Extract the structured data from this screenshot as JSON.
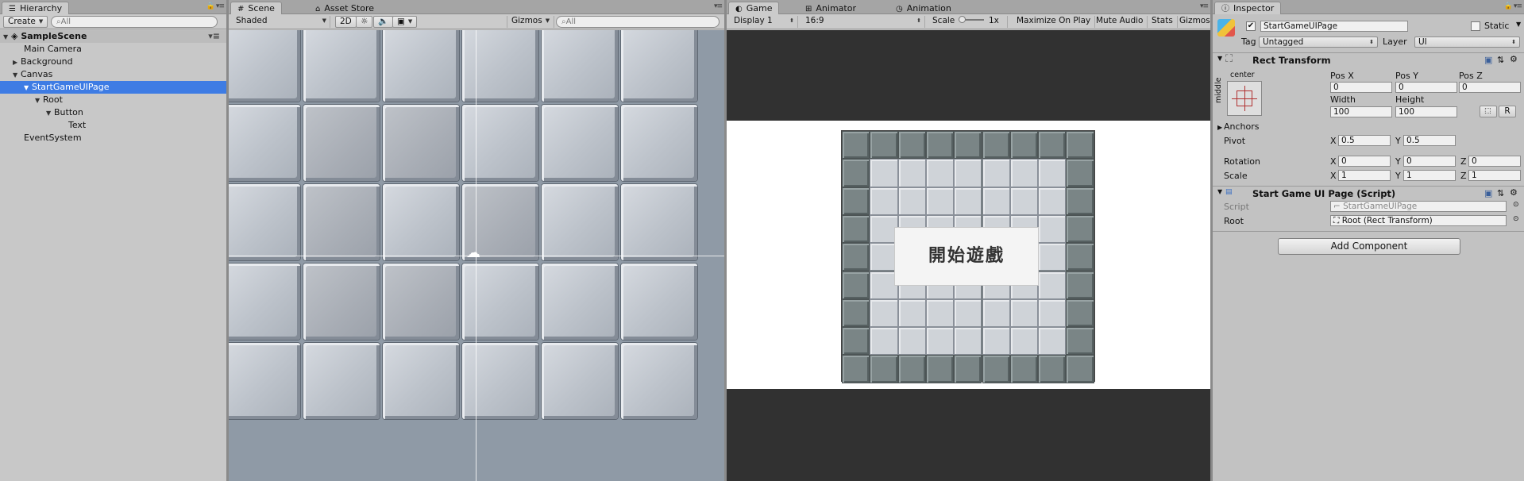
{
  "hierarchy": {
    "tab": "Hierarchy",
    "create_label": "Create",
    "search_placeholder": "All",
    "scene_name": "SampleScene",
    "items": [
      {
        "label": "Main Camera"
      },
      {
        "label": "Background"
      },
      {
        "label": "Canvas"
      },
      {
        "label": "StartGameUIPage"
      },
      {
        "label": "Root"
      },
      {
        "label": "Button"
      },
      {
        "label": "Text"
      },
      {
        "label": "EventSystem"
      }
    ]
  },
  "scene": {
    "tabs": [
      "Scene",
      "Asset Store"
    ],
    "shading_mode": "Shaded",
    "mode_2d": "2D",
    "gizmos_label": "Gizmos",
    "search_placeholder": "All"
  },
  "game": {
    "tabs": [
      "Game",
      "Animator",
      "Animation"
    ],
    "display": "Display 1",
    "aspect": "16:9",
    "scale_label": "Scale",
    "scale_value": "1x",
    "maximize_on_play": "Maximize On Play",
    "mute_audio": "Mute Audio",
    "stats": "Stats",
    "gizmos": "Gizmos",
    "start_button_text": "開始遊戲"
  },
  "inspector": {
    "tab": "Inspector",
    "object_name": "StartGameUIPage",
    "static_label": "Static",
    "tag_label": "Tag",
    "tag_value": "Untagged",
    "layer_label": "Layer",
    "layer_value": "UI",
    "rect_transform": {
      "title": "Rect Transform",
      "anchor_h": "center",
      "anchor_v": "middle",
      "pos_x_label": "Pos X",
      "pos_x": "0",
      "pos_y_label": "Pos Y",
      "pos_y": "0",
      "pos_z_label": "Pos Z",
      "pos_z": "0",
      "width_label": "Width",
      "width": "100",
      "height_label": "Height",
      "height": "100",
      "r_button": "R",
      "anchors_label": "Anchors",
      "pivot_label": "Pivot",
      "pivot_x": "0.5",
      "pivot_y": "0.5",
      "rotation_label": "Rotation",
      "rot_x": "0",
      "rot_y": "0",
      "rot_z": "0",
      "scale_label": "Scale",
      "scale_x": "1",
      "scale_y": "1",
      "scale_z": "1",
      "x": "X",
      "y": "Y",
      "z": "Z"
    },
    "script_component": {
      "title": "Start Game UI Page (Script)",
      "script_label": "Script",
      "script_value": "StartGameUIPage",
      "root_label": "Root",
      "root_value": "Root (Rect Transform)"
    },
    "add_component": "Add Component"
  }
}
